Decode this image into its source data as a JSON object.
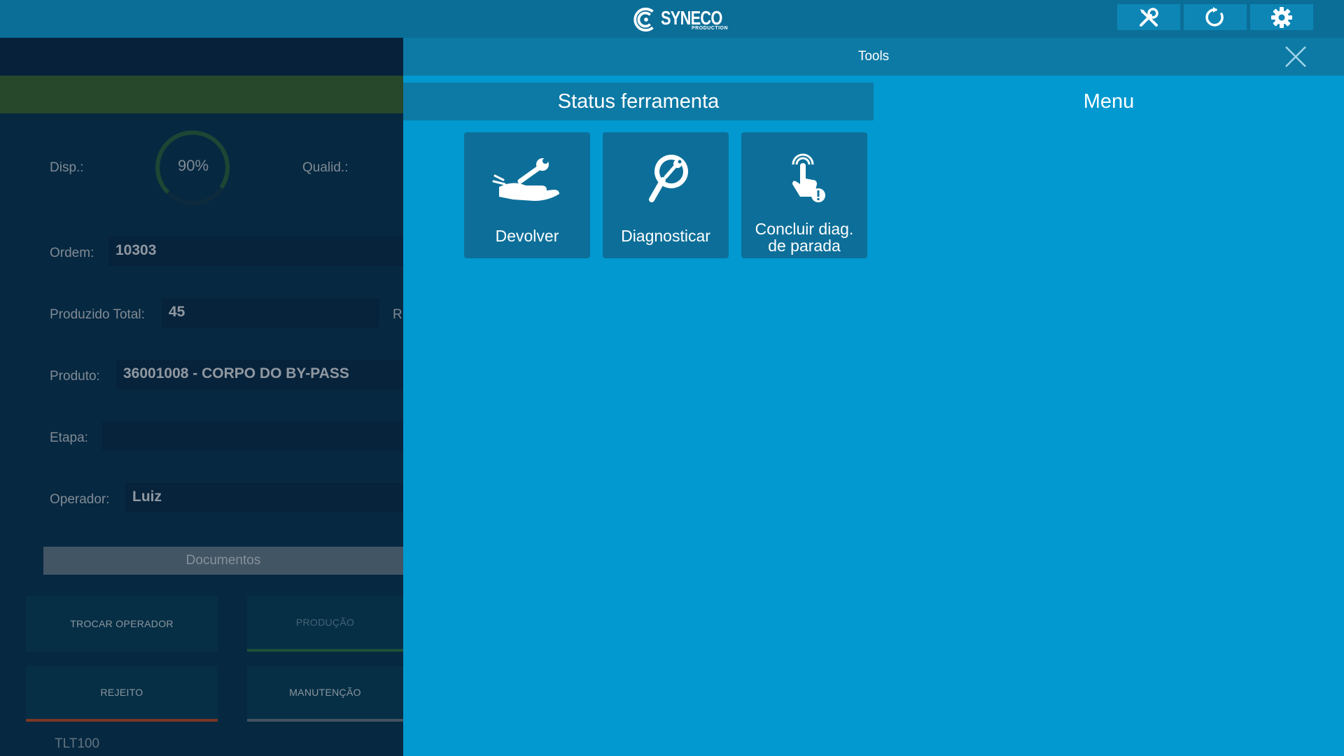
{
  "app": {
    "brand_name": "SYNECO",
    "brand_sub": "PRODUCTION"
  },
  "topbar": {
    "buttons": [
      {
        "icon": "tools-icon"
      },
      {
        "icon": "refresh-icon"
      },
      {
        "icon": "settings-icon"
      }
    ]
  },
  "background": {
    "disp_label": "Disp.:",
    "disp_value": "90%",
    "disp_percent": 90,
    "qualid_label": "Qualid.:",
    "ordem_label": "Ordem:",
    "ordem_value": "10303",
    "produzido_label": "Produzido Total:",
    "produzido_value": "45",
    "produzido_clipped": "R",
    "produto_label": "Produto:",
    "produto_value": "36001008 - CORPO DO BY-PASS",
    "etapa_label": "Etapa:",
    "etapa_value": "",
    "operador_label": "Operador:",
    "operador_value": "Luiz",
    "documentos_label": "Documentos",
    "actions": {
      "trocar_operador": "TROCAR OPERADOR",
      "producao": "PRODUÇÃO",
      "rejeito": "REJEITO",
      "manutencao": "MANUTENÇÃO"
    },
    "machine": "TLT100",
    "colors": {
      "green_bar": "#3f6e36",
      "rejeito_accent": "#c8552a",
      "producao_accent": "#2f7d4a"
    }
  },
  "tools": {
    "title": "Tools",
    "tabs": [
      "Status ferramenta",
      "Menu"
    ],
    "active_tab": "Status ferramenta",
    "items": [
      {
        "label_line1": "Devolver",
        "label_line2": "",
        "icon": "hand-wrench-icon"
      },
      {
        "label_line1": "Diagnosticar",
        "label_line2": "",
        "icon": "magnifier-wrench-icon"
      },
      {
        "label_line1": "Concluir diag.",
        "label_line2": "de parada",
        "icon": "touch-alert-icon"
      }
    ]
  }
}
